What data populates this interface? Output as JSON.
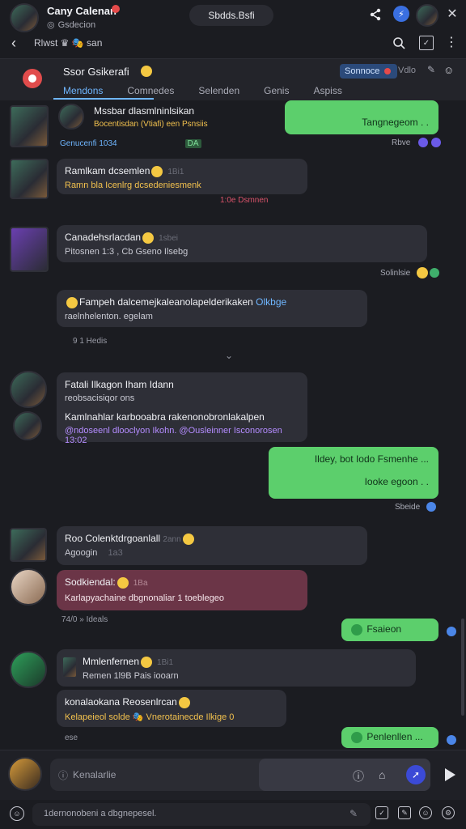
{
  "topbar": {
    "name": "Cany Calenan",
    "handle": "Gsdecion",
    "status_line": "Rlwst ♛ 🎭 san",
    "title_pill": "Sbdds.Bsfi"
  },
  "channel": {
    "title": "Ssor Gsikerafi",
    "tabs": [
      "Mendons",
      "Comnedes",
      "Selenden",
      "Genis",
      "Aspiss"
    ],
    "chip_label": "Sonnoce",
    "chip_right": "Vdlo"
  },
  "messages": {
    "m1": {
      "title": "Mssbar dlasmlninlsikan",
      "line2": "Bocentisdan (Vtiafi) een Psnsiis",
      "meta": "Genucenfi 1034",
      "tag": "DA"
    },
    "o1": {
      "text": "Tangnegeom . ."
    },
    "o1_meta": "Rbve",
    "m2": {
      "title": "Ramlkam dcsemlen",
      "badge": "1Bi1",
      "line2": "Ramn bla Icenlrg dcsedeniesmenk",
      "meta": "1:0e Dsmnen"
    },
    "m3": {
      "title": "Canadehsrlacdan",
      "badge": "1sbei",
      "line2": "Pitosnen 1:3 , Cb Gseno Ilsebg"
    },
    "m3_meta": "Solinlsie",
    "m4": {
      "title": "Fampeh dalcemejkaleanolapelderikaken",
      "link": "Olkbge",
      "line2": "raelnhelenton. egelam",
      "meta": "9 1 Hedis"
    },
    "m5": {
      "title": "Fatali Ilkagon Iham Idann",
      "line2": "reobsacisiqor ons",
      "line3": "Kamlnahlar karbooabra rakenonobronlakalpen",
      "line4": "@ndoseenl dlooclyon Ikohn. @Ousleinner Isconorosen 13:02"
    },
    "o2": {
      "line1": "Ildey, bot Iodo Fsmenhe ...",
      "line2": "Iooke egoon . ."
    },
    "o2_meta": "Sbeide",
    "m6": {
      "title": "Roo Colenktdrgoanlall",
      "badge": "2ann",
      "line2": "Agoogin",
      "line2b": "1a3"
    },
    "m7": {
      "title": "Sodkiendal:",
      "badge": "1Ba",
      "line2": "Karlapyachaine dbgnonaliar 1 toeblegeo"
    },
    "m7_meta": "74/0 » Ideals",
    "o3": {
      "text": "Fsaieon"
    },
    "m8": {
      "title": "Mmlenfernen",
      "badge": "1Bi1",
      "line2": "Remen 1l9B Pais iooarn"
    },
    "m9": {
      "title": "konalaokana Reosenlrcan",
      "line2": "Kelapeieol solde 🎭 Vnerotainecde Ilkige 0"
    },
    "m9_meta": "ese",
    "o4": {
      "text": "Penlenllen ..."
    }
  },
  "composer": {
    "placeholder": "Kenalarlie",
    "bottom_text": "1dernonobeni a dbgnepesel."
  },
  "colors": {
    "accent": "#6fb6ff",
    "outgoing": "#5ccf6c",
    "bubble": "#2e2f37",
    "highlight": "#6b3547"
  }
}
